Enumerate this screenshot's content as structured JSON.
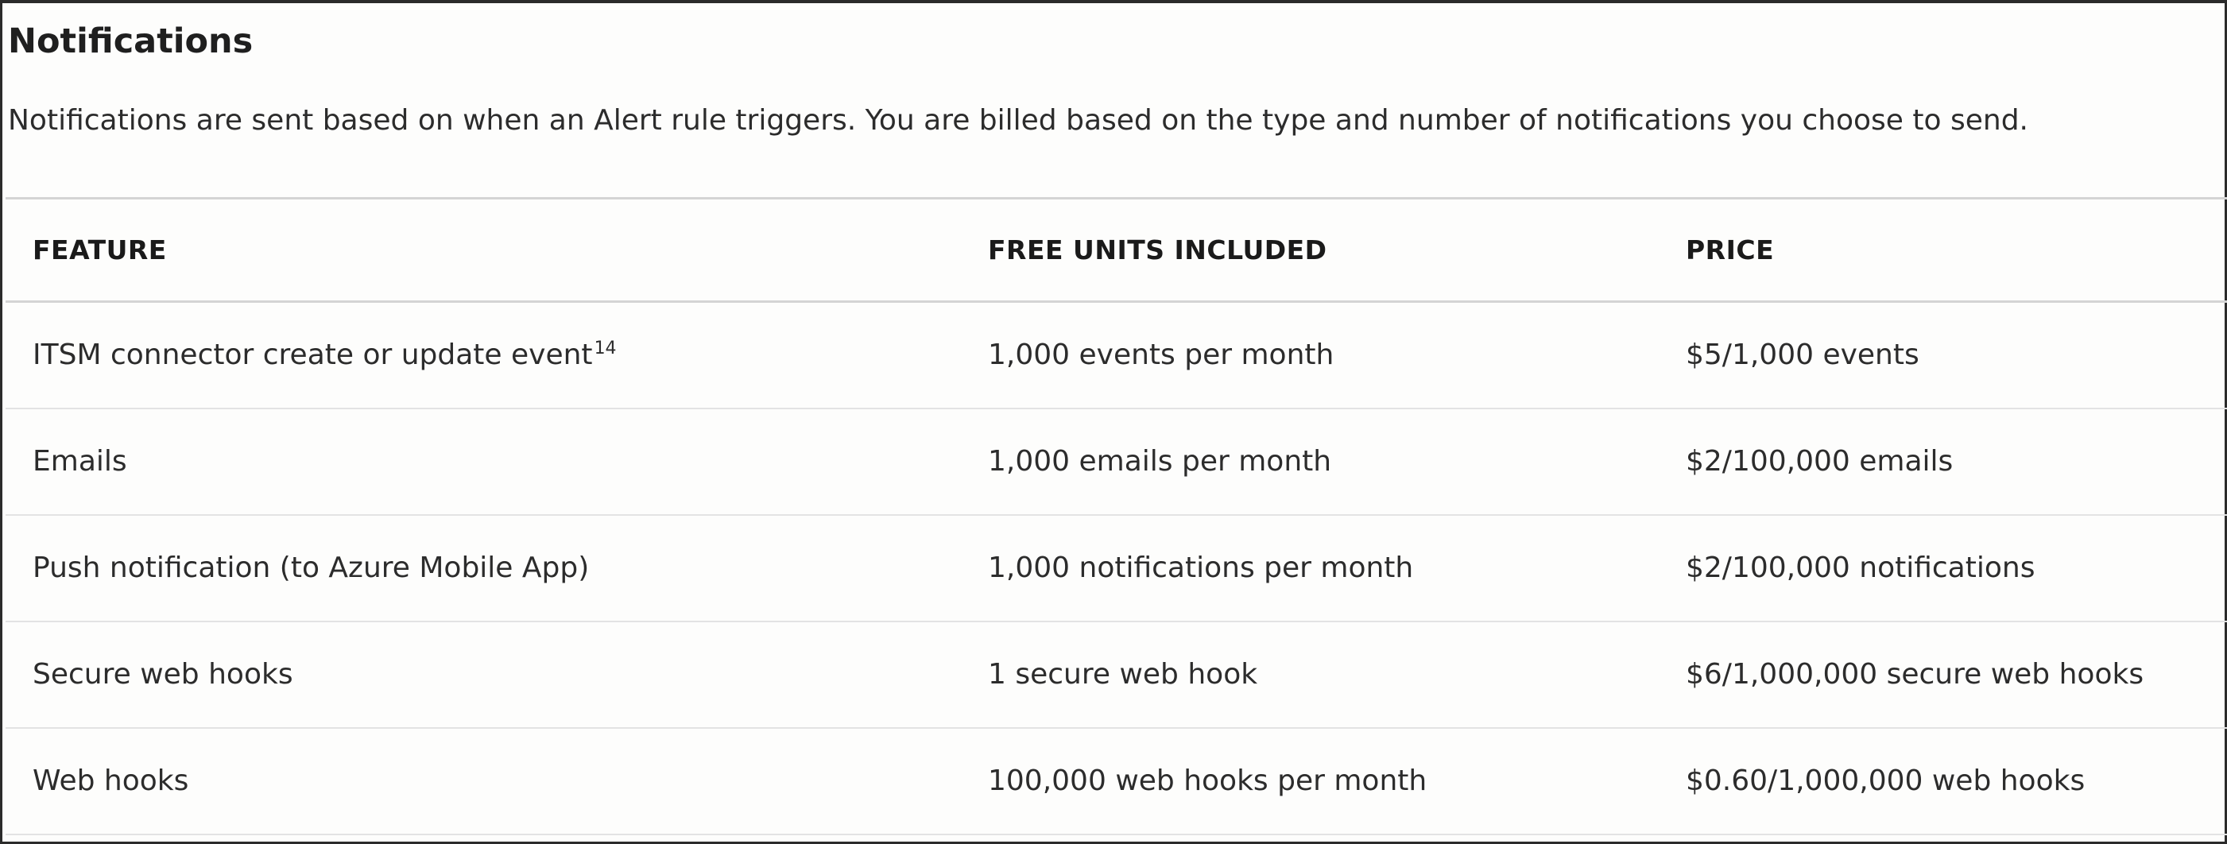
{
  "section": {
    "title": "Notifications",
    "description": "Notifications are sent based on when an Alert rule triggers. You are billed based on the type and number of notifications you choose to send."
  },
  "table": {
    "headers": [
      "FEATURE",
      "FREE UNITS INCLUDED",
      "PRICE"
    ],
    "rows": [
      {
        "feature": "ITSM connector create or update event",
        "footnote": "14",
        "free_units": "1,000 events per month",
        "price": "$5/1,000 events"
      },
      {
        "feature": "Emails",
        "footnote": "",
        "free_units": "1,000 emails per month",
        "price": "$2/100,000 emails"
      },
      {
        "feature": "Push notification (to Azure Mobile App)",
        "footnote": "",
        "free_units": "1,000 notifications per month",
        "price": "$2/100,000 notifications"
      },
      {
        "feature": "Secure web hooks",
        "footnote": "",
        "free_units": "1 secure web hook",
        "price": "$6/1,000,000 secure web hooks"
      },
      {
        "feature": "Web hooks",
        "footnote": "",
        "free_units": "100,000 web hooks per month",
        "price": "$0.60/1,000,000 web hooks"
      }
    ]
  },
  "colors": {
    "background": "#fdfdfc",
    "text": "#2c2c2c",
    "border": "#2b2b2b",
    "divider": "#d4d4d4"
  }
}
